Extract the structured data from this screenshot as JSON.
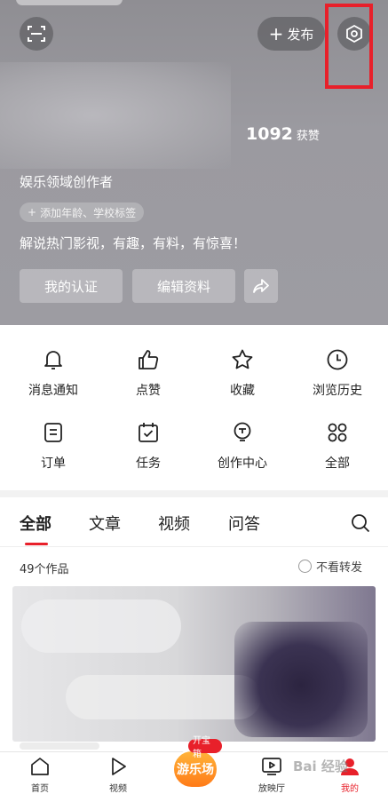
{
  "header": {
    "publish_label": "发布",
    "likes_count": "1092",
    "likes_label": "获赞",
    "creator_title": "娱乐领域创作者",
    "tag_chip": "添加年龄、学校标签",
    "bio": "解说热门影视，有趣，有料，有惊喜！",
    "verify_label": "我的认证",
    "edit_label": "编辑资料",
    "icons": [
      "scan-icon",
      "plus-icon",
      "settings-icon",
      "share-arrow-icon"
    ]
  },
  "grid": {
    "items": [
      {
        "label": "消息通知",
        "icon": "bell-icon"
      },
      {
        "label": "点赞",
        "icon": "thumbs-up-icon"
      },
      {
        "label": "收藏",
        "icon": "star-icon"
      },
      {
        "label": "浏览历史",
        "icon": "clock-icon"
      },
      {
        "label": "订单",
        "icon": "order-icon"
      },
      {
        "label": "任务",
        "icon": "calendar-check-icon"
      },
      {
        "label": "创作中心",
        "icon": "bulb-icon"
      },
      {
        "label": "全部",
        "icon": "grid-icon"
      }
    ]
  },
  "tabs": {
    "items": [
      "全部",
      "文章",
      "视频",
      "问答"
    ],
    "active": "全部"
  },
  "works": {
    "count_label": "49个作品",
    "no_repost_label": "不看转发"
  },
  "bottom_nav": {
    "items": [
      {
        "label": "首页",
        "icon": "home-icon"
      },
      {
        "label": "视频",
        "icon": "play-icon"
      },
      {
        "label": "放映厅",
        "icon": "tv-icon"
      },
      {
        "label": "我的",
        "icon": "user-icon"
      }
    ],
    "game_label": "游乐场",
    "game_tag": "开宝箱",
    "active": "我的"
  },
  "watermark": "Bai 经验",
  "colors": {
    "accent": "#e8202a",
    "header_bg": "#9b9aa0",
    "game_orange": "#ff8a1e"
  }
}
